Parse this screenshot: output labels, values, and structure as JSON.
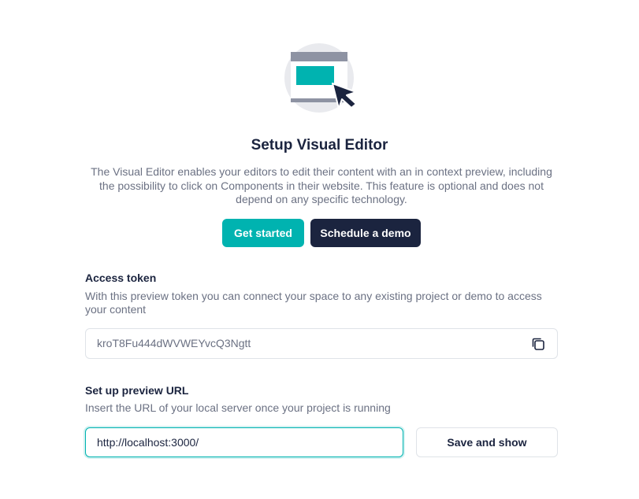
{
  "hero": {
    "icon": "visual-editor-illustration-icon",
    "title": "Setup Visual Editor",
    "description": "The Visual Editor enables your editors to edit their content with an in context preview, including the possibility to click on Components in their website. This feature is optional and does not depend on any specific technology.",
    "primary_button": "Get started",
    "secondary_button": "Schedule a demo"
  },
  "access_token": {
    "label": "Access token",
    "help": "With this preview token you can connect your space to any existing project or demo to access your content",
    "value": "kroT8Fu444dWVWEYvcQ3Ngtt",
    "copy_icon": "copy-icon"
  },
  "preview_url": {
    "label": "Set up preview URL",
    "help": "Insert the URL of your local server once your project is running",
    "value": "http://localhost:3000/",
    "button": "Save and show"
  },
  "colors": {
    "accent": "#00b3b0",
    "dark": "#1b243f",
    "muted_text": "#6b7183",
    "border": "#dfe3e8"
  }
}
